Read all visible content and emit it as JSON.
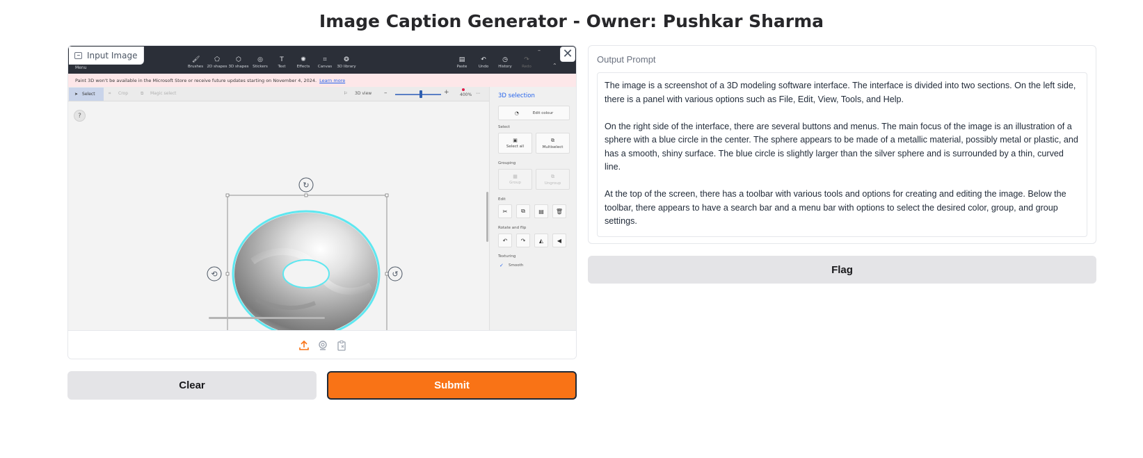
{
  "page": {
    "title": "Image Caption Generator - Owner: Pushkar Sharma"
  },
  "input": {
    "label": "Input Image",
    "close_symbol": "✕",
    "screenshot": {
      "menu_label": "Menu",
      "tools": [
        "Brushes",
        "2D shapes",
        "3D shapes",
        "Stickers",
        "Text",
        "Effects",
        "Canvas",
        "3D library"
      ],
      "right_tools": [
        "Paste",
        "Undo",
        "History",
        "Redo"
      ],
      "banner_text": "Paint 3D won't be available in the Microsoft Store or receive future updates starting on November 4, 2024.",
      "banner_link": "Learn more",
      "toolbar": {
        "select": "Select",
        "crop": "Crop",
        "magic_select": "Magic select",
        "view": "3D view",
        "zoom": "400%"
      },
      "help_symbol": "?",
      "side": {
        "title": "3D selection",
        "edit_colour": "Edit colour",
        "select_label": "Select",
        "select_all": "Select all",
        "multiselect": "Multiselect",
        "grouping_label": "Grouping",
        "group": "Group",
        "ungroup": "Ungroup",
        "edit_label": "Edit",
        "rotate_label": "Rotate and flip",
        "texturing_label": "Texturing",
        "smooth": "Smooth"
      }
    }
  },
  "buttons": {
    "clear": "Clear",
    "submit": "Submit",
    "flag": "Flag"
  },
  "output": {
    "label": "Output Prompt",
    "paragraphs": [
      "The image is a screenshot of a 3D modeling software interface. The interface is divided into two sections. On the left side, there is a panel with various options such as File, Edit, View, Tools, and Help.",
      "On the right side of the interface, there are several buttons and menus. The main focus of the image is an illustration of a sphere with a blue circle in the center. The sphere appears to be made of a metallic material, possibly metal or plastic, and has a smooth, shiny surface. The blue circle is slightly larger than the silver sphere and is surrounded by a thin, curved line.",
      "At the top of the screen, there has a toolbar with various tools and options for creating and editing the image. Below the toolbar, there appears to have a search bar and a menu bar with options to select the desired color, group, and group settings."
    ]
  },
  "colors": {
    "accent": "#f97316",
    "secondary_button": "#e4e4e7",
    "torus_outline": "#5ee7f0"
  }
}
